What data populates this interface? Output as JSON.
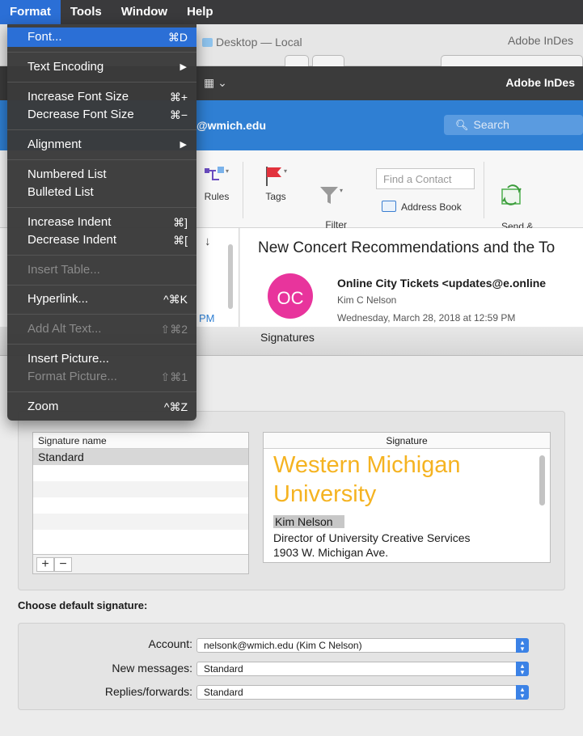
{
  "menubar": {
    "items": [
      "Format",
      "Tools",
      "Window",
      "Help"
    ]
  },
  "finder": {
    "title": "Desktop — Local",
    "adobe": "Adobe InDes"
  },
  "darkbar": {
    "title": "Adobe InDes"
  },
  "outlook": {
    "account": "@wmich.edu",
    "search_placeholder": "Search",
    "ribbon": {
      "rules": "Rules",
      "tags": "Tags",
      "filter": "Filter\nEmail",
      "find_contact": "Find a Contact",
      "address_book": "Address Book",
      "send_receive": "Send &\nReceive"
    },
    "sort_arrow": "↓",
    "time_fragment": "PM",
    "message": {
      "subject": "New Concert Recommendations  and the To",
      "avatar": "OC",
      "from": "Online City Tickets <updates@e.online",
      "to": "Kim C Nelson",
      "date": "Wednesday, March 28, 2018 at 12:59 PM"
    }
  },
  "signatures": {
    "title": "Signatures",
    "list_header": "Signature name",
    "names": [
      "Standard"
    ],
    "editor_header": "Signature",
    "content": {
      "line1": "Western Michigan",
      "line2": "University",
      "name": "Kim Nelson",
      "title": "Director of University Creative Services",
      "address": "1903 W. Michigan Ave."
    },
    "add_label": "+",
    "remove_label": "−",
    "choose_label": "Choose default signature:",
    "account_label": "Account:",
    "account_value": "nelsonk@wmich.edu (Kim C Nelson)",
    "new_label": "New messages:",
    "new_value": "Standard",
    "replies_label": "Replies/forwards:",
    "replies_value": "Standard",
    "accent": "#f5b321"
  },
  "format_menu": {
    "font": {
      "label": "Font...",
      "shortcut": "⌘D"
    },
    "text_encoding": "Text Encoding",
    "increase_font": {
      "label": "Increase Font Size",
      "shortcut": "⌘+"
    },
    "decrease_font": {
      "label": "Decrease Font Size",
      "shortcut": "⌘−"
    },
    "alignment": "Alignment",
    "numbered": "Numbered List",
    "bulleted": "Bulleted List",
    "increase_indent": {
      "label": "Increase Indent",
      "shortcut": "⌘]"
    },
    "decrease_indent": {
      "label": "Decrease Indent",
      "shortcut": "⌘["
    },
    "insert_table": "Insert Table...",
    "hyperlink": {
      "label": "Hyperlink...",
      "shortcut": "^⌘K"
    },
    "alt_text": {
      "label": "Add Alt Text...",
      "shortcut": "⇧⌘2"
    },
    "insert_picture": "Insert Picture...",
    "format_picture": {
      "label": "Format Picture...",
      "shortcut": "⇧⌘1"
    },
    "zoom": {
      "label": "Zoom",
      "shortcut": "^⌘Z"
    }
  }
}
